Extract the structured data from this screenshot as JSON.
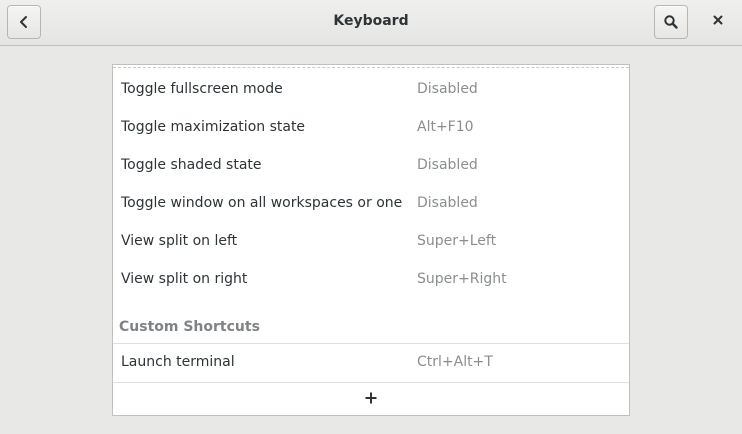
{
  "header": {
    "title": "Keyboard",
    "back_icon": "go-previous-icon",
    "search_icon": "search-icon",
    "close_icon": "close-icon"
  },
  "shortcuts": [
    {
      "name": "Toggle fullscreen mode",
      "accel": "Disabled"
    },
    {
      "name": "Toggle maximization state",
      "accel": "Alt+F10"
    },
    {
      "name": "Toggle shaded state",
      "accel": "Disabled"
    },
    {
      "name": "Toggle window on all workspaces or one",
      "accel": "Disabled"
    },
    {
      "name": "View split on left",
      "accel": "Super+Left"
    },
    {
      "name": "View split on right",
      "accel": "Super+Right"
    }
  ],
  "custom": {
    "section_title": "Custom Shortcuts",
    "items": [
      {
        "name": "Launch terminal",
        "accel": "Ctrl+Alt+T"
      }
    ],
    "add_icon": "plus-icon"
  }
}
